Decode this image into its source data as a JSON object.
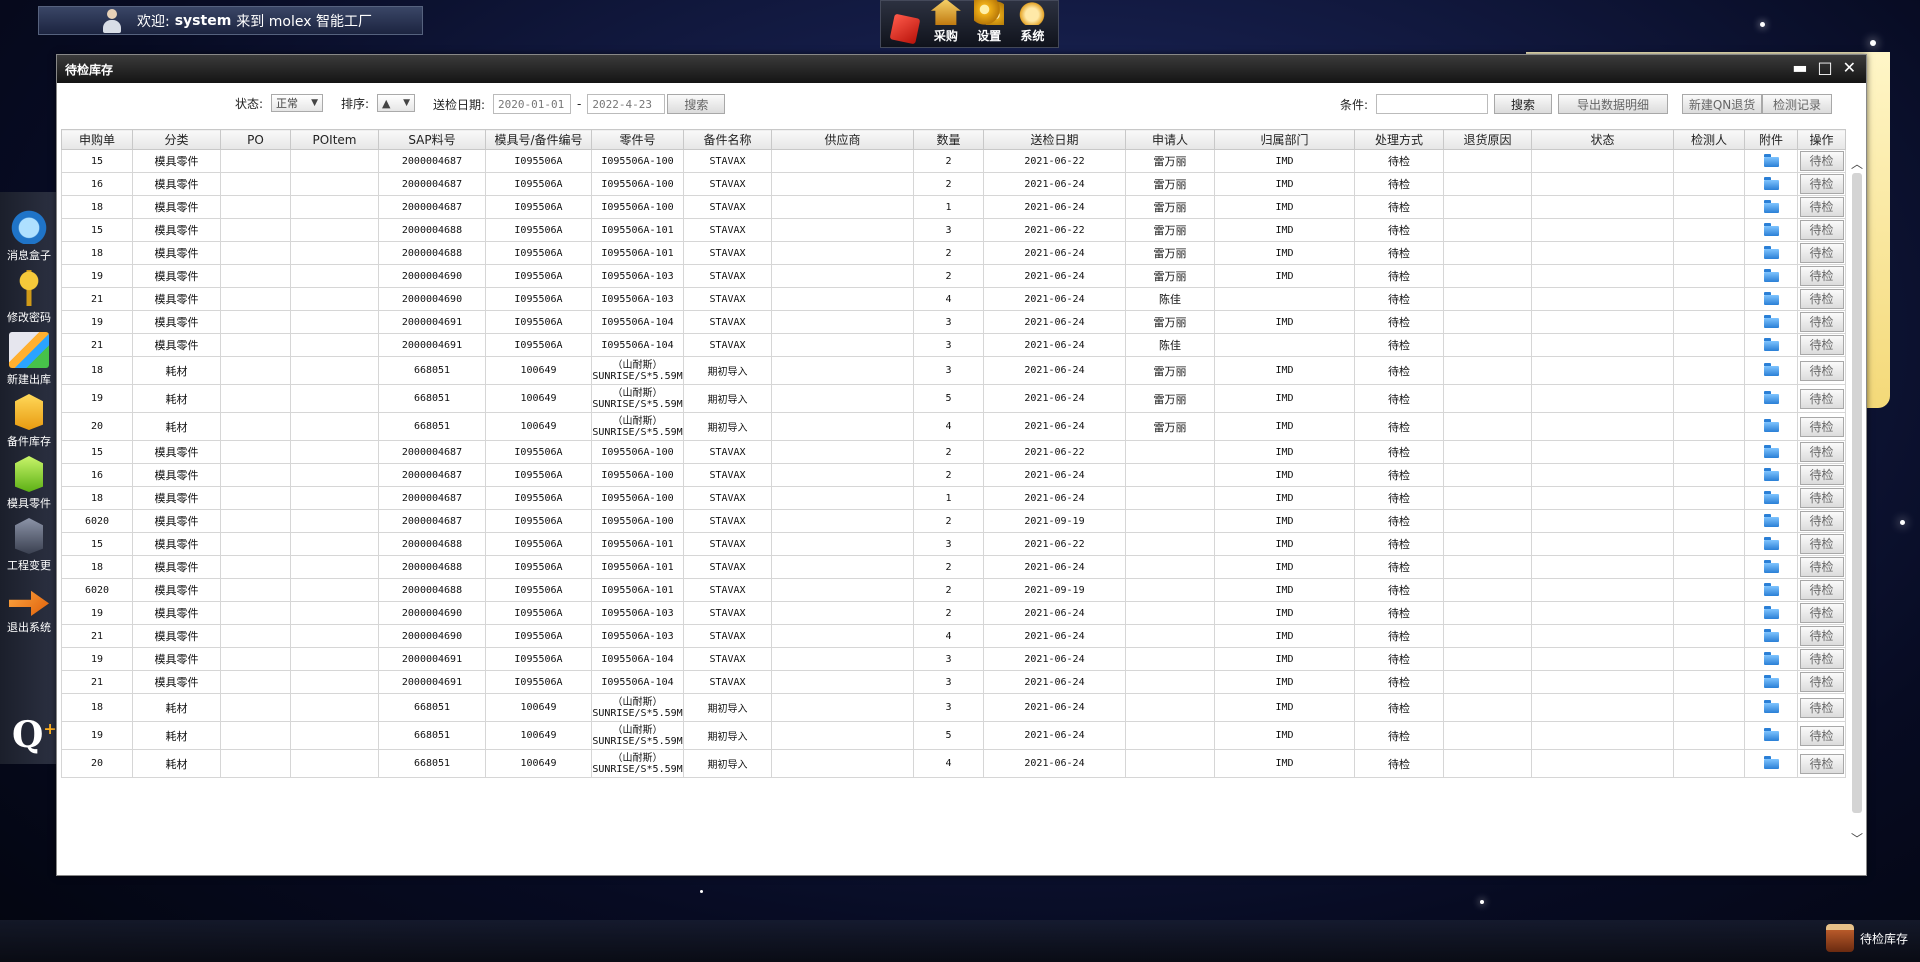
{
  "welcome": {
    "prefix": "欢迎:",
    "user": "system",
    "text": "来到 molex 智能工厂"
  },
  "topmenu": [
    {
      "label": "",
      "icon": "home-cube-icon"
    },
    {
      "label": "采购",
      "icon": "purchase-house-icon"
    },
    {
      "label": "设置",
      "icon": "gears-icon"
    },
    {
      "label": "系统",
      "icon": "system-globe-icon"
    }
  ],
  "dock": [
    {
      "label": "消息盒子",
      "icon": "message-bubble-icon"
    },
    {
      "label": "修改密码",
      "icon": "key-icon"
    },
    {
      "label": "新建出库",
      "icon": "new-outbound-icon"
    },
    {
      "label": "备件库存",
      "icon": "spare-box-icon"
    },
    {
      "label": "模具零件",
      "icon": "mold-box-icon"
    },
    {
      "label": "工程变更",
      "icon": "engineering-box-icon"
    },
    {
      "label": "退出系统",
      "icon": "exit-arrow-icon"
    }
  ],
  "window": {
    "title": "待检库存",
    "ctrl_min": "▬",
    "ctrl_max": "□",
    "ctrl_close": "✕"
  },
  "toolbar": {
    "status_label": "状态:",
    "status_value": "正常",
    "sort_label": "排序:",
    "sort_value": "▲",
    "date_label": "送检日期:",
    "date_from": "2020-01-01",
    "date_sep": "-",
    "date_to": "2022-4-23",
    "search1": "搜索",
    "cond_label": "条件:",
    "cond_value": "",
    "search2": "搜索",
    "export": "导出数据明细",
    "new_qn": "新建QN退货",
    "record": "检测记录"
  },
  "table": {
    "columns": [
      "申购单",
      "分类",
      "PO",
      "POItem",
      "SAP料号",
      "模具号/备件编号",
      "零件号",
      "备件名称",
      "供应商",
      "数量",
      "送检日期",
      "申请人",
      "归属部门",
      "处理方式",
      "退货原因",
      "状态",
      "检测人",
      "附件",
      "操作"
    ],
    "action_label": "待检",
    "rows": [
      {
        "c": [
          "15",
          "模具零件",
          "",
          "",
          "2000004687",
          "I095506A",
          "I095506A-100",
          "STAVAX",
          "",
          "2",
          "2021-06-22",
          "雷万丽",
          "IMD",
          "待检",
          "",
          "",
          ""
        ]
      },
      {
        "c": [
          "16",
          "模具零件",
          "",
          "",
          "2000004687",
          "I095506A",
          "I095506A-100",
          "STAVAX",
          "",
          "2",
          "2021-06-24",
          "雷万丽",
          "IMD",
          "待检",
          "",
          "",
          ""
        ]
      },
      {
        "c": [
          "18",
          "模具零件",
          "",
          "",
          "2000004687",
          "I095506A",
          "I095506A-100",
          "STAVAX",
          "",
          "1",
          "2021-06-24",
          "雷万丽",
          "IMD",
          "待检",
          "",
          "",
          ""
        ]
      },
      {
        "c": [
          "15",
          "模具零件",
          "",
          "",
          "2000004688",
          "I095506A",
          "I095506A-101",
          "STAVAX",
          "",
          "3",
          "2021-06-22",
          "雷万丽",
          "IMD",
          "待检",
          "",
          "",
          ""
        ]
      },
      {
        "c": [
          "18",
          "模具零件",
          "",
          "",
          "2000004688",
          "I095506A",
          "I095506A-101",
          "STAVAX",
          "",
          "2",
          "2021-06-24",
          "雷万丽",
          "IMD",
          "待检",
          "",
          "",
          ""
        ]
      },
      {
        "c": [
          "19",
          "模具零件",
          "",
          "",
          "2000004690",
          "I095506A",
          "I095506A-103",
          "STAVAX",
          "",
          "2",
          "2021-06-24",
          "雷万丽",
          "IMD",
          "待检",
          "",
          "",
          ""
        ]
      },
      {
        "c": [
          "21",
          "模具零件",
          "",
          "",
          "2000004690",
          "I095506A",
          "I095506A-103",
          "STAVAX",
          "",
          "4",
          "2021-06-24",
          "陈佳",
          "",
          "待检",
          "",
          "",
          ""
        ]
      },
      {
        "c": [
          "19",
          "模具零件",
          "",
          "",
          "2000004691",
          "I095506A",
          "I095506A-104",
          "STAVAX",
          "",
          "3",
          "2021-06-24",
          "雷万丽",
          "IMD",
          "待检",
          "",
          "",
          ""
        ]
      },
      {
        "c": [
          "21",
          "模具零件",
          "",
          "",
          "2000004691",
          "I095506A",
          "I095506A-104",
          "STAVAX",
          "",
          "3",
          "2021-06-24",
          "陈佳",
          "",
          "待检",
          "",
          "",
          ""
        ]
      },
      {
        "tall": true,
        "c": [
          "18",
          "耗材",
          "",
          "",
          "668051",
          "100649",
          "（山耐斯）|SUNRISE/S*5.59M",
          "期初导入",
          "",
          "3",
          "2021-06-24",
          "雷万丽",
          "IMD",
          "待检",
          "",
          "",
          ""
        ]
      },
      {
        "tall": true,
        "c": [
          "19",
          "耗材",
          "",
          "",
          "668051",
          "100649",
          "（山耐斯）|SUNRISE/S*5.59M",
          "期初导入",
          "",
          "5",
          "2021-06-24",
          "雷万丽",
          "IMD",
          "待检",
          "",
          "",
          ""
        ]
      },
      {
        "tall": true,
        "c": [
          "20",
          "耗材",
          "",
          "",
          "668051",
          "100649",
          "（山耐斯）|SUNRISE/S*5.59M",
          "期初导入",
          "",
          "4",
          "2021-06-24",
          "雷万丽",
          "IMD",
          "待检",
          "",
          "",
          ""
        ]
      },
      {
        "c": [
          "15",
          "模具零件",
          "",
          "",
          "2000004687",
          "I095506A",
          "I095506A-100",
          "STAVAX",
          "",
          "2",
          "2021-06-22",
          "",
          "IMD",
          "待检",
          "",
          "",
          ""
        ]
      },
      {
        "c": [
          "16",
          "模具零件",
          "",
          "",
          "2000004687",
          "I095506A",
          "I095506A-100",
          "STAVAX",
          "",
          "2",
          "2021-06-24",
          "",
          "IMD",
          "待检",
          "",
          "",
          ""
        ]
      },
      {
        "c": [
          "18",
          "模具零件",
          "",
          "",
          "2000004687",
          "I095506A",
          "I095506A-100",
          "STAVAX",
          "",
          "1",
          "2021-06-24",
          "",
          "IMD",
          "待检",
          "",
          "",
          ""
        ]
      },
      {
        "c": [
          "6020",
          "模具零件",
          "",
          "",
          "2000004687",
          "I095506A",
          "I095506A-100",
          "STAVAX",
          "",
          "2",
          "2021-09-19",
          "",
          "IMD",
          "待检",
          "",
          "",
          ""
        ]
      },
      {
        "c": [
          "15",
          "模具零件",
          "",
          "",
          "2000004688",
          "I095506A",
          "I095506A-101",
          "STAVAX",
          "",
          "3",
          "2021-06-22",
          "",
          "IMD",
          "待检",
          "",
          "",
          ""
        ]
      },
      {
        "c": [
          "18",
          "模具零件",
          "",
          "",
          "2000004688",
          "I095506A",
          "I095506A-101",
          "STAVAX",
          "",
          "2",
          "2021-06-24",
          "",
          "IMD",
          "待检",
          "",
          "",
          ""
        ]
      },
      {
        "c": [
          "6020",
          "模具零件",
          "",
          "",
          "2000004688",
          "I095506A",
          "I095506A-101",
          "STAVAX",
          "",
          "2",
          "2021-09-19",
          "",
          "IMD",
          "待检",
          "",
          "",
          ""
        ]
      },
      {
        "c": [
          "19",
          "模具零件",
          "",
          "",
          "2000004690",
          "I095506A",
          "I095506A-103",
          "STAVAX",
          "",
          "2",
          "2021-06-24",
          "",
          "IMD",
          "待检",
          "",
          "",
          ""
        ]
      },
      {
        "c": [
          "21",
          "模具零件",
          "",
          "",
          "2000004690",
          "I095506A",
          "I095506A-103",
          "STAVAX",
          "",
          "4",
          "2021-06-24",
          "",
          "IMD",
          "待检",
          "",
          "",
          ""
        ]
      },
      {
        "c": [
          "19",
          "模具零件",
          "",
          "",
          "2000004691",
          "I095506A",
          "I095506A-104",
          "STAVAX",
          "",
          "3",
          "2021-06-24",
          "",
          "IMD",
          "待检",
          "",
          "",
          ""
        ]
      },
      {
        "c": [
          "21",
          "模具零件",
          "",
          "",
          "2000004691",
          "I095506A",
          "I095506A-104",
          "STAVAX",
          "",
          "3",
          "2021-06-24",
          "",
          "IMD",
          "待检",
          "",
          "",
          ""
        ]
      },
      {
        "tall": true,
        "c": [
          "18",
          "耗材",
          "",
          "",
          "668051",
          "100649",
          "（山耐斯）|SUNRISE/S*5.59M",
          "期初导入",
          "",
          "3",
          "2021-06-24",
          "",
          "IMD",
          "待检",
          "",
          "",
          ""
        ]
      },
      {
        "tall": true,
        "c": [
          "19",
          "耗材",
          "",
          "",
          "668051",
          "100649",
          "（山耐斯）|SUNRISE/S*5.59M",
          "期初导入",
          "",
          "5",
          "2021-06-24",
          "",
          "IMD",
          "待检",
          "",
          "",
          ""
        ]
      },
      {
        "tall": true,
        "c": [
          "20",
          "耗材",
          "",
          "",
          "668051",
          "100649",
          "（山耐斯）|SUNRISE/S*5.59M",
          "期初导入",
          "",
          "4",
          "2021-06-24",
          "",
          "IMD",
          "待检",
          "",
          "",
          ""
        ]
      }
    ]
  },
  "taskbar": {
    "item": "待检库存"
  }
}
